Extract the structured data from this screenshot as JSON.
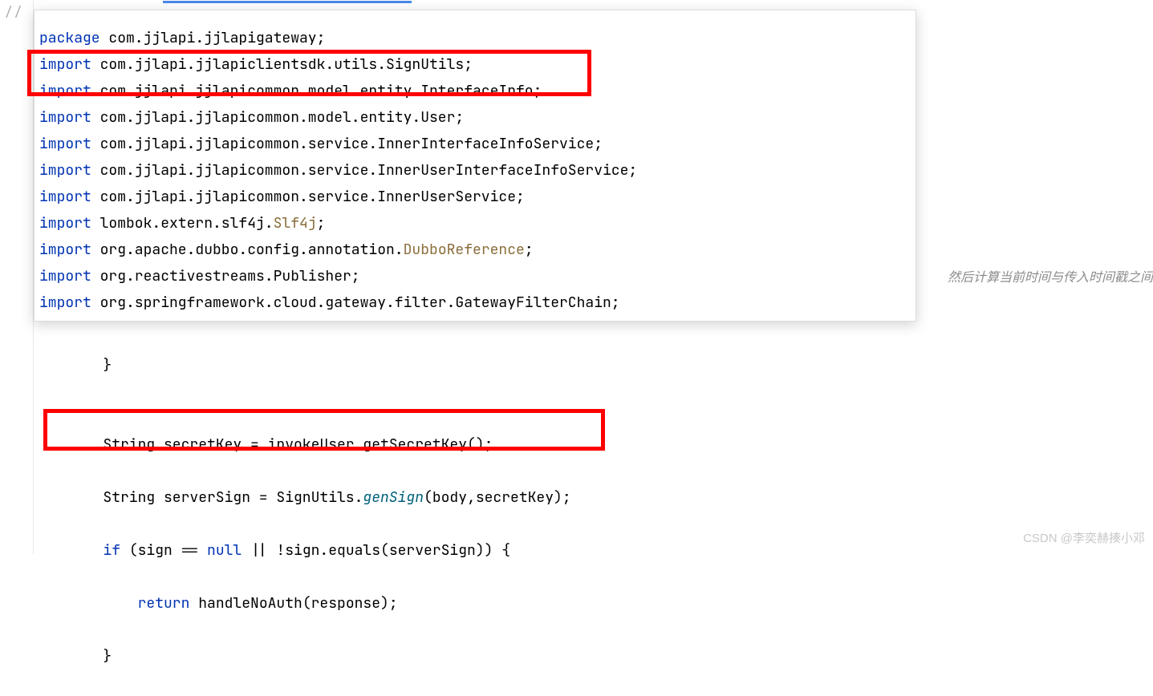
{
  "gutter": {
    "comment_marker": "//"
  },
  "popup": {
    "line1": {
      "kw": "package",
      "rest": " com.jjlapi.jjlapigateway;"
    },
    "blank": "",
    "line2": {
      "kw": "import",
      "rest": " com.jjlapi.jjlapiclientsdk.utils.SignUtils;"
    },
    "line3": {
      "kw": "import",
      "rest": " com.jjlapi.jjlapicommon.model.entity.InterfaceInfo;"
    },
    "line4": {
      "kw": "import",
      "rest": " com.jjlapi.jjlapicommon.model.entity.User;"
    },
    "line5": {
      "kw": "import",
      "rest": " com.jjlapi.jjlapicommon.service.InnerInterfaceInfoService;"
    },
    "line6": {
      "kw": "import",
      "rest": " com.jjlapi.jjlapicommon.service.InnerUserInterfaceInfoService;"
    },
    "line7": {
      "kw": "import",
      "rest": " com.jjlapi.jjlapicommon.service.InnerUserService;"
    },
    "line8": {
      "kw": "import",
      "rest1": " lombok.extern.slf4j.",
      "cls": "Slf4j",
      "rest2": ";"
    },
    "line9": {
      "kw": "import",
      "rest1": " org.apache.dubbo.config.annotation.",
      "cls": "DubboReference",
      "rest2": ";"
    },
    "line10": {
      "kw": "import",
      "rest": " org.reactivestreams.Publisher;"
    },
    "line11": {
      "kw": "import",
      "rest": " org.springframework.cloud.gateway.filter.GatewayFilterChain;"
    }
  },
  "bg": {
    "l1": "        }",
    "l2": "",
    "l3": "        String secretKey = invokeUser.getSecretKey();",
    "l4_pre": "        String serverSign = SignUtils.",
    "l4_method": "genSign",
    "l4_post": "(body,secretKey);",
    "l5_pre": "        ",
    "l5_if": "if",
    "l5_mid": " (sign == ",
    "l5_null": "null",
    "l5_post": " || !sign.equals(serverSign)) {",
    "l6_pre": "            ",
    "l6_ret": "return",
    "l6_post": " handleNoAuth(response);",
    "l7": "        }"
  },
  "remote_comment": "然后计算当前时间与传入时间戳之间",
  "watermark": "CSDN @李奕赫揍小邓"
}
